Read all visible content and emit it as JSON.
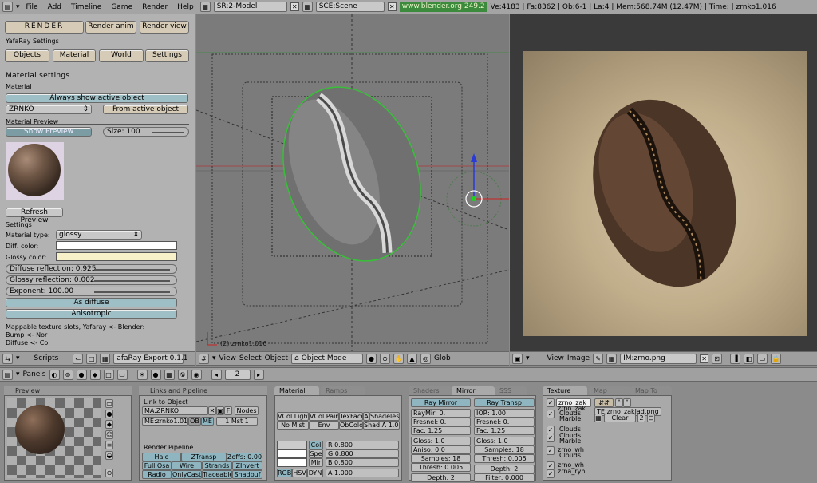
{
  "topbar": {
    "menus": [
      "File",
      "Add",
      "Timeline",
      "Game",
      "Render",
      "Help"
    ],
    "screen": "SR:2-Model",
    "scene": "SCE:Scene",
    "url": "www.blender.org 249.2",
    "stats": "Ve:4183 | Fa:8362 | Ob:6-1 | La:4 | Mem:568.74M (12.47M) | Time: | zrnko1.016"
  },
  "left": {
    "render_btn": "RENDER",
    "render_anim_btn": "Render anim",
    "render_view_btn": "Render view",
    "yafaray_settings": "YafaRay Settings",
    "tabs": [
      "Objects",
      "Material",
      "World",
      "Settings"
    ],
    "material_settings": "Material settings",
    "material_label": "Material",
    "always_show": "Always show active object",
    "material_select": "ZRNKO",
    "from_active": "From active object",
    "material_preview": "Material Preview",
    "show_preview": "Show Preview",
    "size": "Size: 100",
    "refresh": "Refresh Preview",
    "settings": "Settings",
    "material_type_label": "Material type:",
    "material_type": "glossy",
    "diff_color": "Diff. color:",
    "glossy_color": "Glossy color:",
    "diffuse_reflection": "Diffuse reflection: 0.925",
    "glossy_reflection": "Glossy reflection: 0.002",
    "exponent": "Exponent: 100.00",
    "as_diffuse": "As diffuse",
    "anisotropic": "Anisotropic",
    "mappable": "Mappable texture slots, Yafaray <- Blender:",
    "bump": "Bump <- Nor",
    "diffuse": "Diffuse <- Col",
    "scripts": "Scripts",
    "export": "afaRay Export 0.1.1"
  },
  "viewport": {
    "object_label": "(2) zrnko1.016",
    "menus": [
      "View",
      "Select",
      "Object"
    ],
    "mode": "Object Mode",
    "glob": "Glob"
  },
  "image_editor": {
    "menus": [
      "View",
      "Image"
    ],
    "image": "IM:zrno.png"
  },
  "buttons_header": {
    "panels": "Panels",
    "frame": "2"
  },
  "preview_panel": {
    "title": "Preview"
  },
  "links_panel": {
    "title": "Links and Pipeline",
    "link_to_object": "Link to Object",
    "ma": "MA:ZRNKO",
    "f": "F",
    "nodes": "Nodes",
    "me": "ME:zrnko1.016",
    "ob": "OB",
    "me_btn": "ME",
    "mst": "1 Mst 1",
    "render_pipeline": "Render Pipeline",
    "row1": [
      "Halo",
      "ZTransp",
      "Zoffs: 0.00"
    ],
    "row2": [
      "Full Osa",
      "Wire",
      "Strands",
      "ZInvert"
    ],
    "row3": [
      "Radio",
      "OnlyCast",
      "Traceable",
      "Shadbuf"
    ]
  },
  "material_panel": {
    "tabs": [
      "Material",
      "Ramps"
    ],
    "row1": [
      "VCol Light",
      "VCol Paint",
      "TexFace",
      "A",
      "Shadeless"
    ],
    "row2": [
      "No Mist",
      "Env",
      "ObColor",
      "Shad A 1.00"
    ],
    "col_btns": [
      "Col",
      "Spe",
      "Mir"
    ],
    "rgb": [
      "R 0.800",
      "G 0.800",
      "B 0.800"
    ],
    "modes": [
      "RGB",
      "HSV",
      "DYN"
    ],
    "alpha": "A 1.000"
  },
  "mirror_panel": {
    "tabs": [
      "Shaders",
      "Mirror Transp",
      "SSS"
    ],
    "ray_mirror": "Ray Mirror",
    "ray_transp": "Ray Transp",
    "left": [
      "RayMir: 0.",
      "Fresnel: 0.",
      "Fac: 1.25",
      "Gloss: 1.0",
      "Aniso: 0.0",
      "Samples: 18",
      "Thresh: 0.005",
      "Depth: 2"
    ],
    "right": [
      "IOR: 1.00",
      "Fresnel: 0.",
      "Fac: 1.25",
      "Gloss: 1.0",
      "Samples: 18",
      "Thresh: 0.005",
      "Depth: 2",
      "Filter: 0.000"
    ]
  },
  "texture_panel": {
    "tabs": [
      "Texture",
      "Map Input",
      "Map To"
    ],
    "slots": [
      "zrno_zak",
      "zrno_zak",
      "Clouds",
      "Marble",
      "Clouds",
      "Clouds",
      "Marble",
      "zrno_wh",
      "Clouds",
      "zrno_wh",
      "zrna_ryh"
    ],
    "te": "TE:zrno_zaklad.png",
    "clear": "Clear",
    "num": "2"
  }
}
